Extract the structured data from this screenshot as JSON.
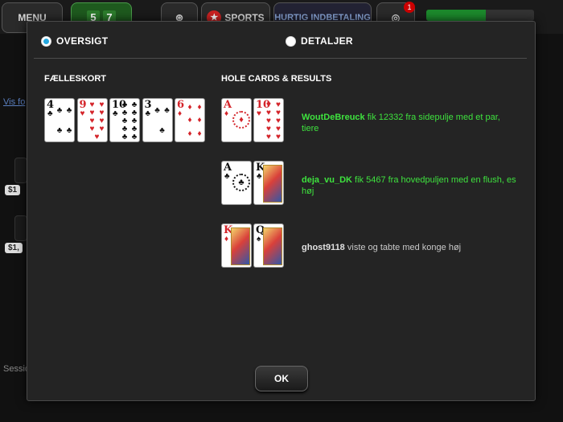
{
  "topbar": {
    "menu_label": "MENU",
    "counter_digits": [
      "5",
      "7"
    ],
    "sports_label": "SPORTS",
    "deposit_label": "HURTIG INDBETALING",
    "notification_count": "1",
    "progress_fraction": 0.55,
    "progress_color": "#1c8a2c"
  },
  "background": {
    "show_link": "Vis fo",
    "session_label": "Sessio",
    "stacks": [
      "$1",
      "$1,"
    ]
  },
  "modal": {
    "tabs": [
      {
        "label": "OVERSIGT",
        "selected": true
      },
      {
        "label": "DETALJER",
        "selected": false
      }
    ],
    "community_title": "FÆLLESKORT",
    "hole_title": "HOLE CARDS & RESULTS",
    "community_cards": [
      {
        "rank": "4",
        "suit": "♣",
        "color": "black"
      },
      {
        "rank": "9",
        "suit": "♥",
        "color": "red"
      },
      {
        "rank": "10",
        "suit": "♣",
        "color": "black"
      },
      {
        "rank": "3",
        "suit": "♣",
        "color": "black"
      },
      {
        "rank": "6",
        "suit": "♦",
        "color": "red"
      }
    ],
    "results": [
      {
        "cards": [
          {
            "rank": "A",
            "suit": "♦",
            "color": "red"
          },
          {
            "rank": "10",
            "suit": "♥",
            "color": "red"
          }
        ],
        "player": "WoutDeBreuck",
        "text": " fik 12332 fra sidepulje med et par, tiere",
        "winner": true
      },
      {
        "cards": [
          {
            "rank": "A",
            "suit": "♣",
            "color": "black"
          },
          {
            "rank": "K",
            "suit": "♣",
            "color": "black"
          }
        ],
        "player": "deja_vu_DK",
        "text": " fik 5467 fra hovedpuljen med en flush, es høj",
        "winner": true
      },
      {
        "cards": [
          {
            "rank": "K",
            "suit": "♦",
            "color": "red"
          },
          {
            "rank": "Q",
            "suit": "♠",
            "color": "black"
          }
        ],
        "player": "ghost9118",
        "text": " viste og tabte med konge høj",
        "winner": false
      }
    ],
    "ok_label": "OK"
  }
}
